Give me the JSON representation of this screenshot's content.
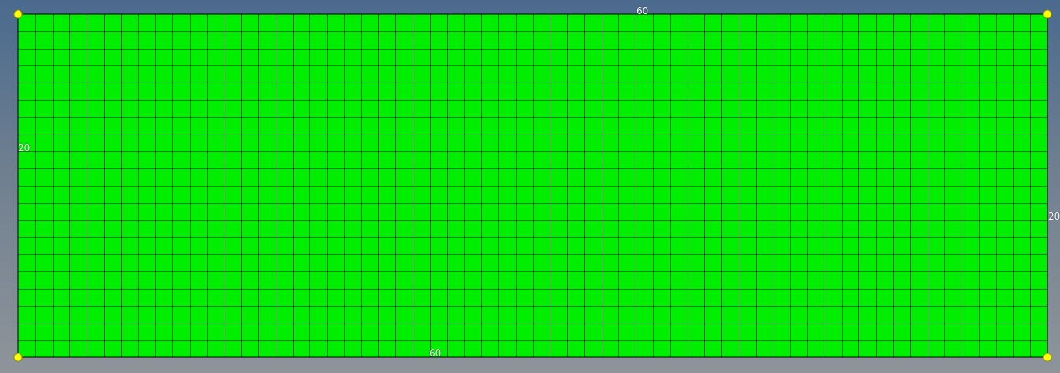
{
  "mesh": {
    "columns": 60,
    "rows": 20,
    "fill_color": "#00ee00",
    "line_color": "#000000",
    "corner_node_color": "#ffff00",
    "corner_node_count": 4
  },
  "edge_labels": {
    "top": "60",
    "bottom": "60",
    "left": "20",
    "right": "20"
  }
}
